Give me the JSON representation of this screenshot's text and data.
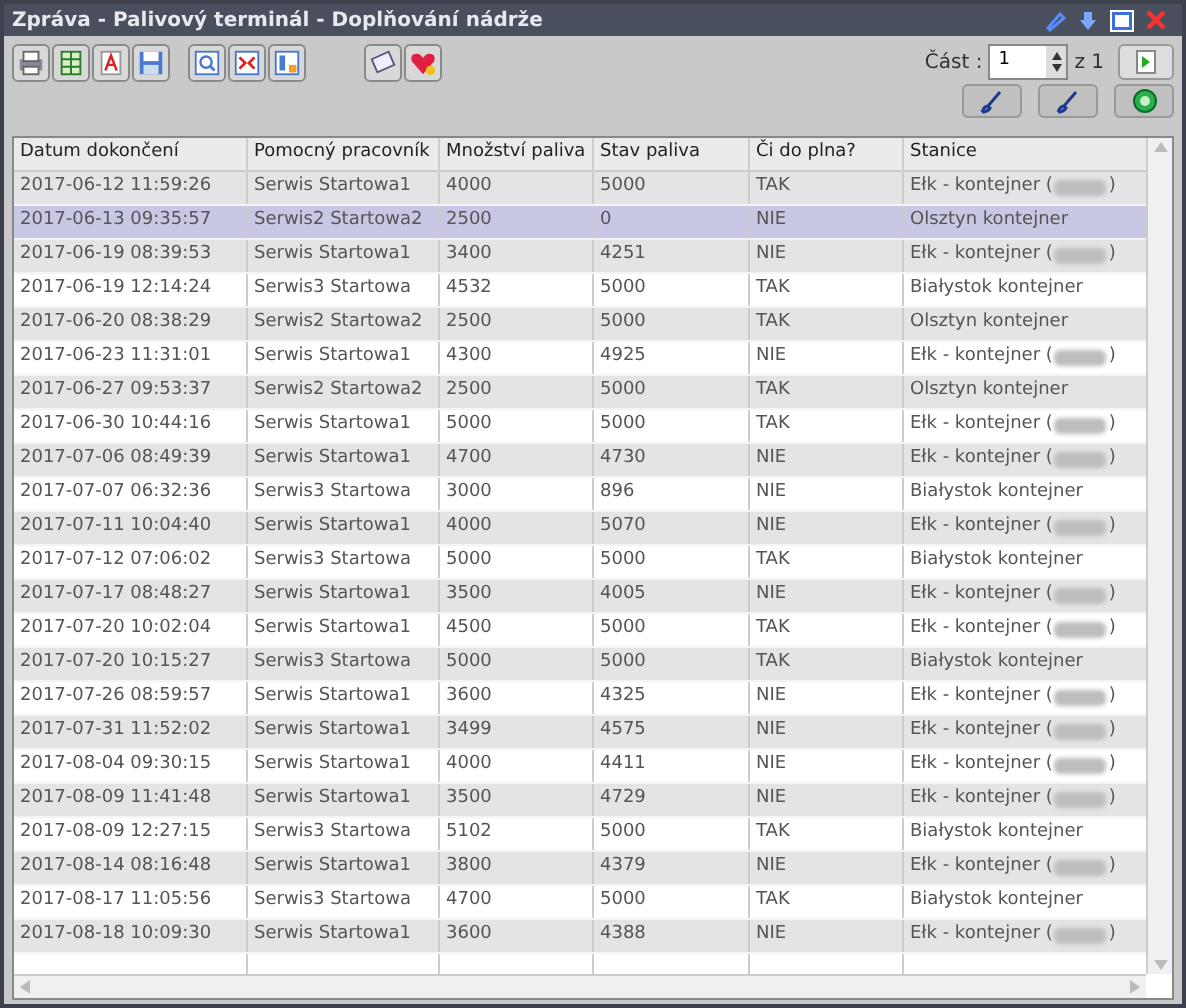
{
  "window": {
    "title": "Zpráva - Palivový terminál - Doplňování nádrže"
  },
  "part": {
    "label": "Část :",
    "value": "1",
    "total": "z 1"
  },
  "table": {
    "columns": [
      "Datum dokončení",
      "Pomocný pracovník",
      "Množství paliva",
      "Stav paliva",
      "Či do plna?",
      "Stanice"
    ],
    "rows": [
      {
        "cells": [
          "2017-06-12 11:59:26",
          "Serwis Startowa1",
          "4000",
          "5000",
          "TAK",
          "Ełk - kontejner ("
        ],
        "redacted": true,
        "selected": false
      },
      {
        "cells": [
          "2017-06-13 09:35:57",
          "Serwis2 Startowa2",
          "2500",
          "0",
          "NIE",
          "Olsztyn kontejner"
        ],
        "redacted": false,
        "selected": true
      },
      {
        "cells": [
          "2017-06-19 08:39:53",
          "Serwis Startowa1",
          "3400",
          "4251",
          "NIE",
          "Ełk - kontejner ("
        ],
        "redacted": true,
        "selected": false
      },
      {
        "cells": [
          "2017-06-19 12:14:24",
          "Serwis3 Startowa",
          "4532",
          "5000",
          "TAK",
          "Białystok kontejner"
        ],
        "redacted": false,
        "selected": false
      },
      {
        "cells": [
          "2017-06-20 08:38:29",
          "Serwis2 Startowa2",
          "2500",
          "5000",
          "TAK",
          "Olsztyn kontejner"
        ],
        "redacted": false,
        "selected": false
      },
      {
        "cells": [
          "2017-06-23 11:31:01",
          "Serwis Startowa1",
          "4300",
          "4925",
          "NIE",
          "Ełk - kontejner ("
        ],
        "redacted": true,
        "selected": false
      },
      {
        "cells": [
          "2017-06-27 09:53:37",
          "Serwis2 Startowa2",
          "2500",
          "5000",
          "TAK",
          "Olsztyn kontejner"
        ],
        "redacted": false,
        "selected": false
      },
      {
        "cells": [
          "2017-06-30 10:44:16",
          "Serwis Startowa1",
          "5000",
          "5000",
          "TAK",
          "Ełk - kontejner ("
        ],
        "redacted": true,
        "selected": false
      },
      {
        "cells": [
          "2017-07-06 08:49:39",
          "Serwis Startowa1",
          "4700",
          "4730",
          "NIE",
          "Ełk - kontejner ("
        ],
        "redacted": true,
        "selected": false
      },
      {
        "cells": [
          "2017-07-07 06:32:36",
          "Serwis3 Startowa",
          "3000",
          "896",
          "NIE",
          "Białystok kontejner"
        ],
        "redacted": false,
        "selected": false
      },
      {
        "cells": [
          "2017-07-11 10:04:40",
          "Serwis Startowa1",
          "4000",
          "5070",
          "NIE",
          "Ełk - kontejner ("
        ],
        "redacted": true,
        "selected": false
      },
      {
        "cells": [
          "2017-07-12 07:06:02",
          "Serwis3 Startowa",
          "5000",
          "5000",
          "TAK",
          "Białystok  kontejner"
        ],
        "redacted": false,
        "selected": false
      },
      {
        "cells": [
          "2017-07-17 08:48:27",
          "Serwis Startowa1",
          "3500",
          "4005",
          "NIE",
          "Ełk - kontejner ("
        ],
        "redacted": true,
        "selected": false
      },
      {
        "cells": [
          "2017-07-20 10:02:04",
          "Serwis Startowa1",
          "4500",
          "5000",
          "TAK",
          "Ełk - kontejner ("
        ],
        "redacted": true,
        "selected": false
      },
      {
        "cells": [
          "2017-07-20 10:15:27",
          "Serwis3 Startowa",
          "5000",
          "5000",
          "TAK",
          "Białystok kontejner"
        ],
        "redacted": false,
        "selected": false
      },
      {
        "cells": [
          "2017-07-26 08:59:57",
          "Serwis Startowa1",
          "3600",
          "4325",
          "NIE",
          "Ełk - kontejner ("
        ],
        "redacted": true,
        "selected": false
      },
      {
        "cells": [
          "2017-07-31 11:52:02",
          "Serwis Startowa1",
          "3499",
          "4575",
          "NIE",
          "Ełk - kontejner ("
        ],
        "redacted": true,
        "selected": false
      },
      {
        "cells": [
          "2017-08-04 09:30:15",
          "Serwis Startowa1",
          "4000",
          "4411",
          "NIE",
          "Ełk - kontejner ("
        ],
        "redacted": true,
        "selected": false
      },
      {
        "cells": [
          "2017-08-09 11:41:48",
          "Serwis Startowa1",
          "3500",
          "4729",
          "NIE",
          "Ełk - kontejner ("
        ],
        "redacted": true,
        "selected": false
      },
      {
        "cells": [
          "2017-08-09 12:27:15",
          "Serwis3 Startowa",
          "5102",
          "5000",
          "TAK",
          "Białystok kontejner"
        ],
        "redacted": false,
        "selected": false
      },
      {
        "cells": [
          "2017-08-14 08:16:48",
          "Serwis Startowa1",
          "3800",
          "4379",
          "NIE",
          "Ełk - kontejner ("
        ],
        "redacted": true,
        "selected": false
      },
      {
        "cells": [
          "2017-08-17 11:05:56",
          "Serwis3 Startowa",
          "4700",
          "5000",
          "TAK",
          "Białystok  kontejner"
        ],
        "redacted": false,
        "selected": false
      },
      {
        "cells": [
          "2017-08-18 10:09:30",
          "Serwis Startowa1",
          "3600",
          "4388",
          "NIE",
          "Ełk - kontejner ("
        ],
        "redacted": true,
        "selected": false
      }
    ],
    "redaction_close": ")"
  }
}
